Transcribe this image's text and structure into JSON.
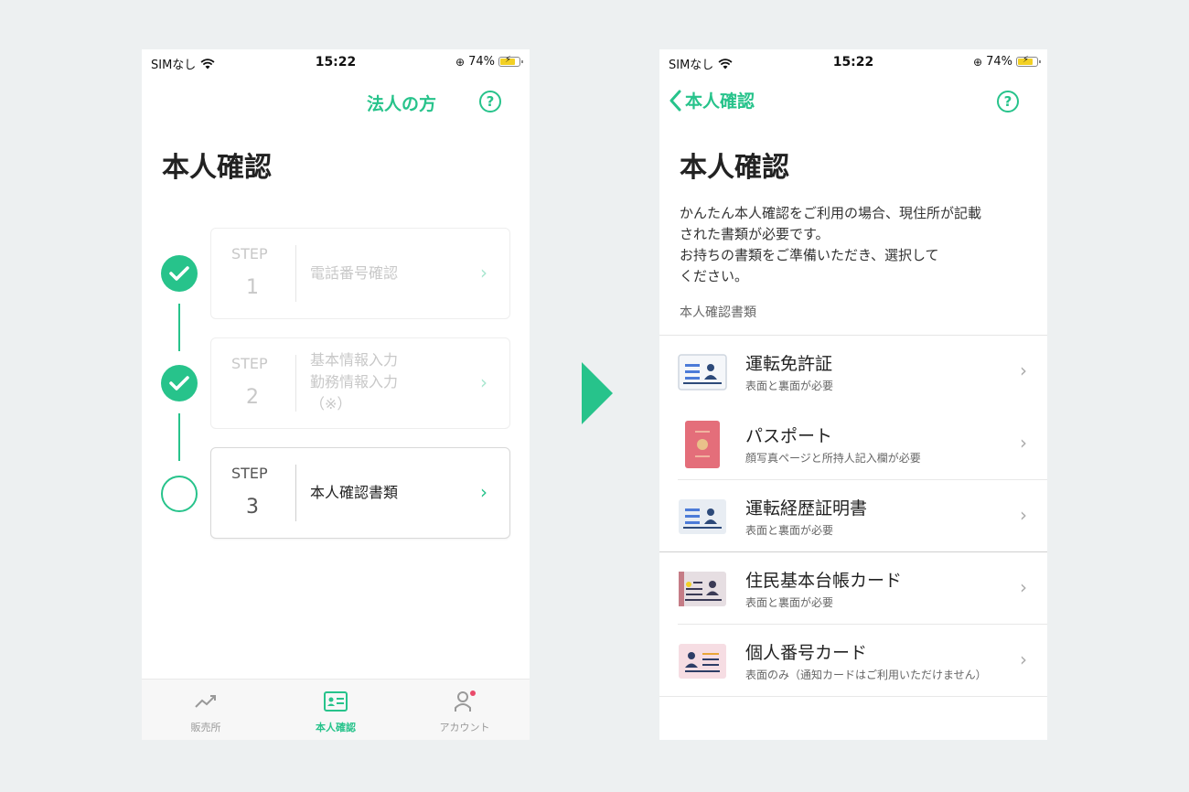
{
  "status": {
    "carrier": "SIMなし",
    "time": "15:22",
    "battery": "74%"
  },
  "colors": {
    "accent": "#27c38b"
  },
  "left": {
    "header_link": "法人の方",
    "help": "?",
    "title": "本人確認",
    "steps": [
      {
        "label": "STEP",
        "num": "1",
        "lines": [
          "電話番号確認"
        ],
        "done": true
      },
      {
        "label": "STEP",
        "num": "2",
        "lines": [
          "基本情報入力",
          "勤務情報入力",
          "（※）"
        ],
        "done": true
      },
      {
        "label": "STEP",
        "num": "3",
        "lines": [
          "本人確認書類"
        ],
        "done": false
      }
    ],
    "chevron": "›",
    "tabs": [
      {
        "label": "販売所",
        "icon": "trend-chart-icon"
      },
      {
        "label": "本人確認",
        "icon": "id-card-icon",
        "active": true
      },
      {
        "label": "アカウント",
        "icon": "person-icon"
      }
    ]
  },
  "right": {
    "back_label": "本人確認",
    "help": "?",
    "title": "本人確認",
    "description_lines": [
      "かんたん本人確認をご利用の場合、現住所が記載",
      "された書類が必要です。",
      "お持ちの書類をご準備いただき、選択して",
      "ください。"
    ],
    "section_label": "本人確認書類",
    "documents": [
      {
        "name": "運転免許証",
        "sub": "表面と裏面が必要",
        "icon": "license-card-icon"
      },
      {
        "name": "パスポート",
        "sub": "顔写真ページと所持人記入欄が必要",
        "icon": "passport-icon"
      },
      {
        "name": "運転経歴証明書",
        "sub": "表面と裏面が必要",
        "icon": "driving-record-card-icon"
      },
      {
        "name": "住民基本台帳カード",
        "sub": "表面と裏面が必要",
        "icon": "resident-card-icon"
      },
      {
        "name": "個人番号カード",
        "sub": "表面のみ（通知カードはご利用いただけません）",
        "icon": "mynumber-card-icon"
      }
    ],
    "chevron": "›"
  }
}
